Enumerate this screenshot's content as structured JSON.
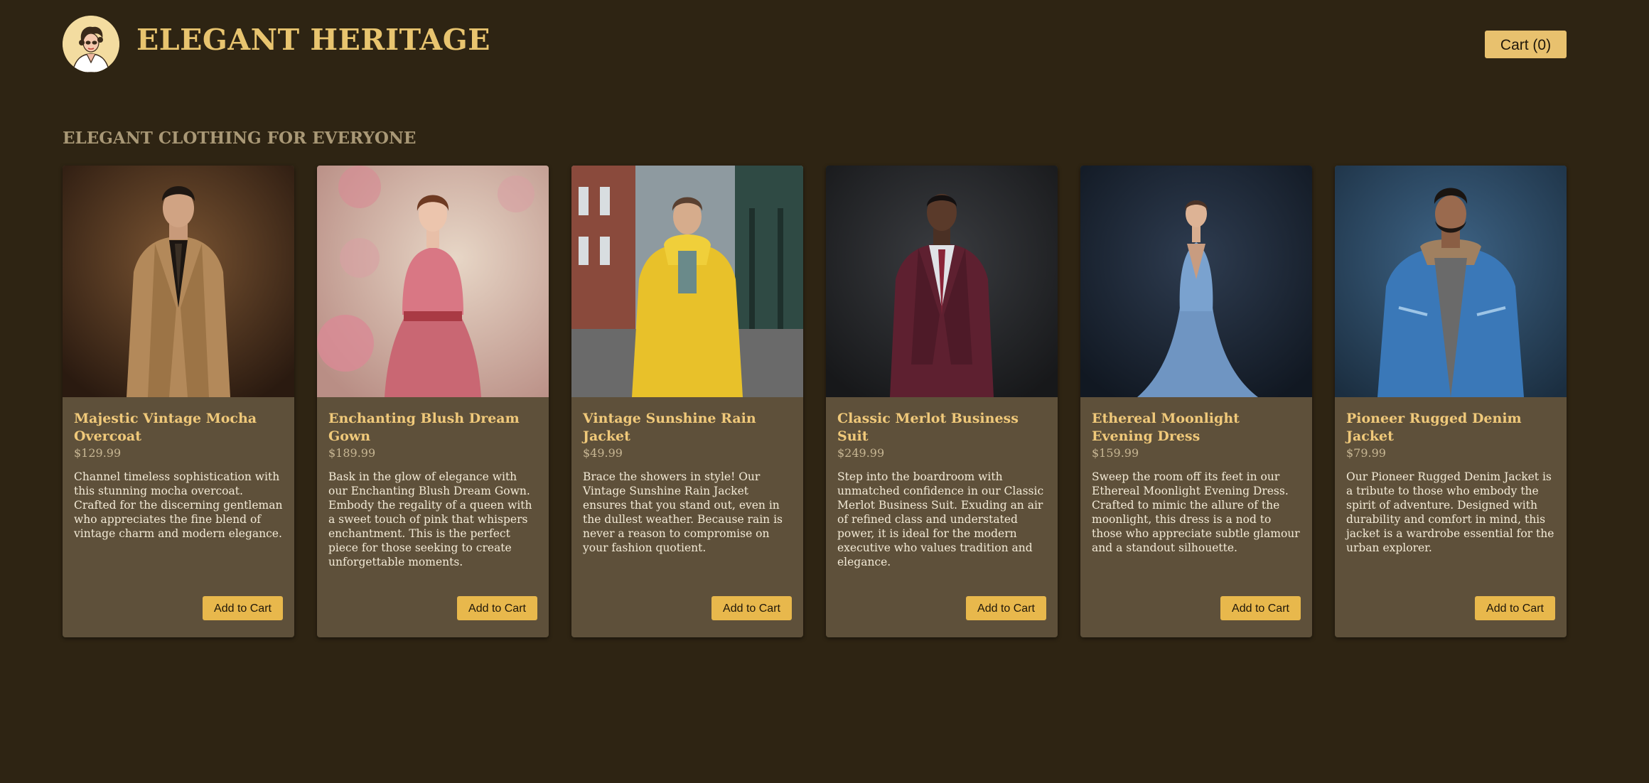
{
  "header": {
    "brand": "ELEGANT HERITAGE",
    "logo_icon": "vintage-woman-portrait-icon",
    "cart_label": "Cart (0)"
  },
  "section": {
    "title": "ELEGANT CLOTHING FOR EVERYONE"
  },
  "colors": {
    "background": "#2e2413",
    "card": "#5e503a",
    "brand": "#e8c46f",
    "accent_button": "#e8b84c"
  },
  "products": [
    {
      "title": "Majestic Vintage Mocha Overcoat",
      "price": "$129.99",
      "description": "Channel timeless sophistication with this stunning mocha overcoat. Crafted for the discerning gentleman who appreciates the fine blend of vintage charm and modern elegance.",
      "button": "Add to Cart",
      "image": "man-in-mocha-trench-coat-photo"
    },
    {
      "title": "Enchanting Blush Dream Gown",
      "price": "$189.99",
      "description": "Bask in the glow of elegance with our Enchanting Blush Dream Gown. Embody the regality of a queen with a sweet touch of pink that whispers enchantment. This is the perfect piece for those seeking to create unforgettable moments.",
      "button": "Add to Cart",
      "image": "woman-in-pink-gown-photo"
    },
    {
      "title": "Vintage Sunshine Rain Jacket",
      "price": "$49.99",
      "description": "Brace the showers in style! Our Vintage Sunshine Rain Jacket ensures that you stand out, even in the dullest weather. Because rain is never a reason to compromise on your fashion quotient.",
      "button": "Add to Cart",
      "image": "man-in-yellow-rain-jacket-photo"
    },
    {
      "title": "Classic Merlot Business Suit",
      "price": "$249.99",
      "description": "Step into the boardroom with unmatched confidence in our Classic Merlot Business Suit. Exuding an air of refined class and understated power, it is ideal for the modern executive who values tradition and elegance.",
      "button": "Add to Cart",
      "image": "man-in-merlot-suit-photo"
    },
    {
      "title": "Ethereal Moonlight Evening Dress",
      "price": "$159.99",
      "description": "Sweep the room off its feet in our Ethereal Moonlight Evening Dress. Crafted to mimic the allure of the moonlight, this dress is a nod to those who appreciate subtle glamour and a standout silhouette.",
      "button": "Add to Cart",
      "image": "woman-in-blue-evening-dress-photo"
    },
    {
      "title": "Pioneer Rugged Denim Jacket",
      "price": "$79.99",
      "description": "Our Pioneer Rugged Denim Jacket is a tribute to those who embody the spirit of adventure. Designed with durability and comfort in mind, this jacket is a wardrobe essential for the urban explorer.",
      "button": "Add to Cart",
      "image": "man-in-denim-jacket-photo"
    }
  ]
}
